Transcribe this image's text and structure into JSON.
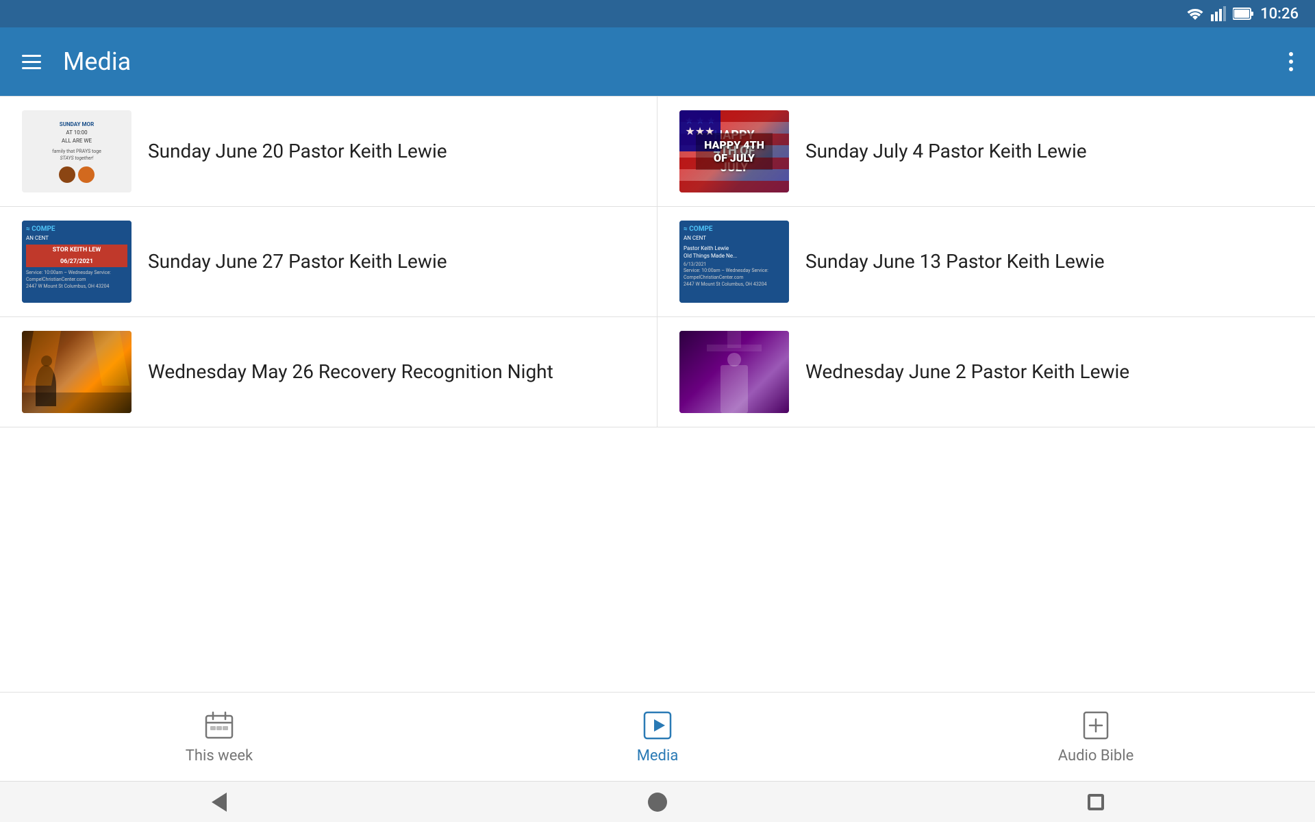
{
  "statusBar": {
    "time": "10:26"
  },
  "appBar": {
    "title": "Media",
    "menuLabel": "Menu",
    "moreLabel": "More options"
  },
  "mediaItems": [
    {
      "id": "item-1",
      "label": "Sunday June 20 Pastor Keith Lewie",
      "thumbType": "church-flyer",
      "thumbText": "SUNDAY MOR AT 10:0 ALL ARE WE family that PRAYS toge STAYS together!"
    },
    {
      "id": "item-2",
      "label": "Sunday July 4 Pastor Keith Lewie",
      "thumbType": "july4",
      "thumbText": "HAPPY 4TH OF JULY"
    },
    {
      "id": "item-3",
      "label": "Sunday June 27 Pastor Keith Lewie",
      "thumbType": "compel-blue",
      "thumbText": "COMPEL CHRISTIAN CEN STOR KEITH LEW 06/27/2021 Service: 10:00am CompelChristianCenter.com"
    },
    {
      "id": "item-4",
      "label": "Sunday June 13 Pastor Keith Lewie",
      "thumbType": "compel-blue-2",
      "thumbText": "COMPEL CHRISTIAN CEN Pastor Keith Lewie Old Things Made Ne 6/13/2021 Service: 10:00am CompelChristianCenter.com"
    },
    {
      "id": "item-5",
      "label": "Wednesday May 26 Recovery Recognition Night",
      "thumbType": "performance",
      "thumbText": ""
    },
    {
      "id": "item-6",
      "label": "Wednesday June 2 Pastor Keith Lewie",
      "thumbType": "purple-speaker",
      "thumbText": ""
    }
  ],
  "bottomNav": {
    "items": [
      {
        "id": "this-week",
        "label": "This week",
        "active": false
      },
      {
        "id": "media",
        "label": "Media",
        "active": true
      },
      {
        "id": "audio-bible",
        "label": "Audio Bible",
        "active": false
      }
    ]
  },
  "systemNav": {
    "back": "back",
    "home": "home",
    "recents": "recents"
  }
}
